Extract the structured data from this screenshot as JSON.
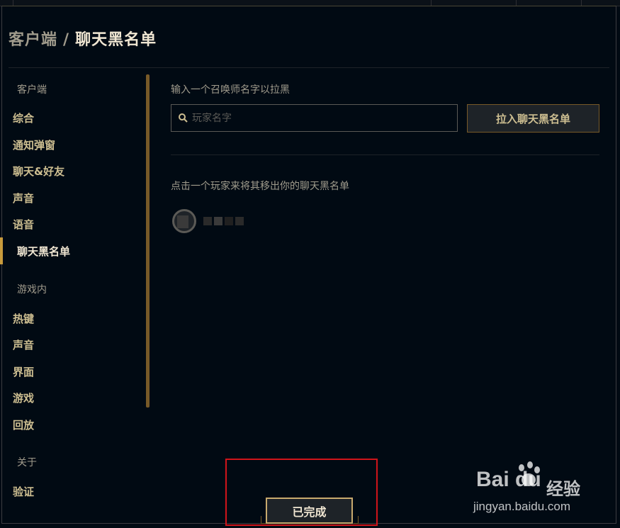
{
  "breadcrumb": {
    "parent": "客户端",
    "separator": "/",
    "current": "聊天黑名单"
  },
  "sidebar": {
    "section_client": "客户端",
    "client_items": [
      {
        "label": "综合"
      },
      {
        "label": "通知弹窗"
      },
      {
        "label": "聊天&好友"
      },
      {
        "label": "声音"
      },
      {
        "label": "语音"
      },
      {
        "label": "聊天黑名单",
        "active": true
      }
    ],
    "section_ingame": "游戏内",
    "ingame_items": [
      {
        "label": "热键"
      },
      {
        "label": "声音"
      },
      {
        "label": "界面"
      },
      {
        "label": "游戏"
      },
      {
        "label": "回放"
      }
    ],
    "section_about": "关于",
    "about_items": [
      {
        "label": "验证"
      }
    ]
  },
  "blacklist": {
    "input_hint": "输入一个召唤师名字以拉黑",
    "search_placeholder": "玩家名字",
    "search_value": "",
    "add_button": "拉入聊天黑名单",
    "remove_hint": "点击一个玩家来将其移出你的聊天黑名单"
  },
  "footer": {
    "done_button": "已完成"
  },
  "watermark": {
    "logo": "Bai du",
    "product": "经验",
    "url": "jingyan.baidu.com"
  },
  "colors": {
    "background": "#010a13",
    "gold": "#c89b3c",
    "gold_text": "#cdbe91",
    "highlight": "#d0141a"
  }
}
